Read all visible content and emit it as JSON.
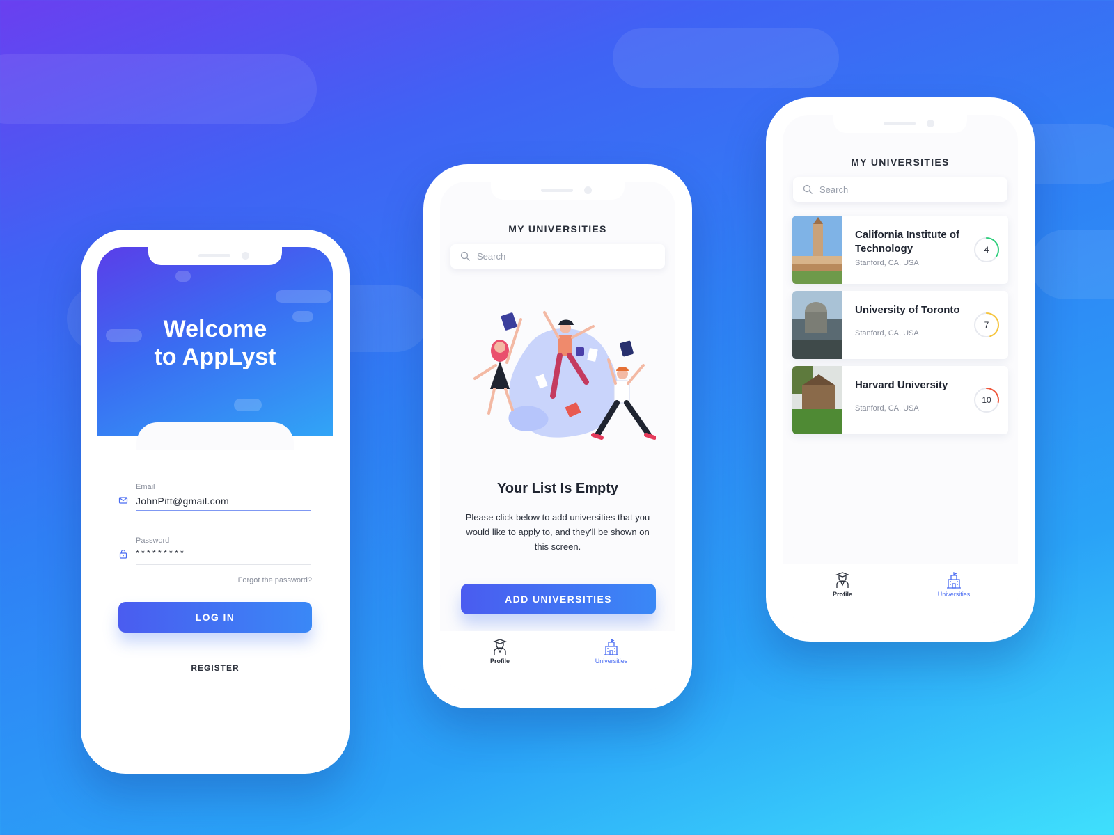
{
  "login": {
    "welcome_line1": "Welcome",
    "welcome_line2": "to AppLyst",
    "email_label": "Email",
    "email_value": "JohnPitt@gmail.com",
    "password_label": "Password",
    "password_value": "* * * * * * * * *",
    "forgot": "Forgot the password?",
    "login_button": "LOG IN",
    "register_link": "REGISTER"
  },
  "empty_screen": {
    "title": "MY UNIVERSITIES",
    "search_placeholder": "Search",
    "empty_title": "Your List Is Empty",
    "empty_body": "Please click below to add universities that you would like to apply to, and they'll be shown on this screen.",
    "add_button": "ADD UNIVERSITIES",
    "tabs": [
      {
        "label": "Profile",
        "icon": "graduate-icon",
        "active": false
      },
      {
        "label": "Universities",
        "icon": "university-icon",
        "active": true
      }
    ]
  },
  "list_screen": {
    "title": "MY UNIVERSITIES",
    "search_placeholder": "Search",
    "universities": [
      {
        "name": "California Institute of Technology",
        "location": "Stanford, CA, USA",
        "score": "4",
        "score_fraction": 0.35,
        "score_color": "#2fcf7c"
      },
      {
        "name": "University of Toronto",
        "location": "Stanford, CA, USA",
        "score": "7",
        "score_fraction": 0.45,
        "score_color": "#f7c53b"
      },
      {
        "name": "Harvard University",
        "location": "Stanford, CA, USA",
        "score": "10",
        "score_fraction": 0.28,
        "score_color": "#f0553a"
      }
    ],
    "tabs": [
      {
        "label": "Profile",
        "icon": "graduate-icon",
        "active": false
      },
      {
        "label": "Universities",
        "icon": "university-icon",
        "active": true
      }
    ]
  },
  "colors": {
    "accent": "#4a6cf2",
    "button_start": "#4a5cf0",
    "button_end": "#3a88f6"
  }
}
